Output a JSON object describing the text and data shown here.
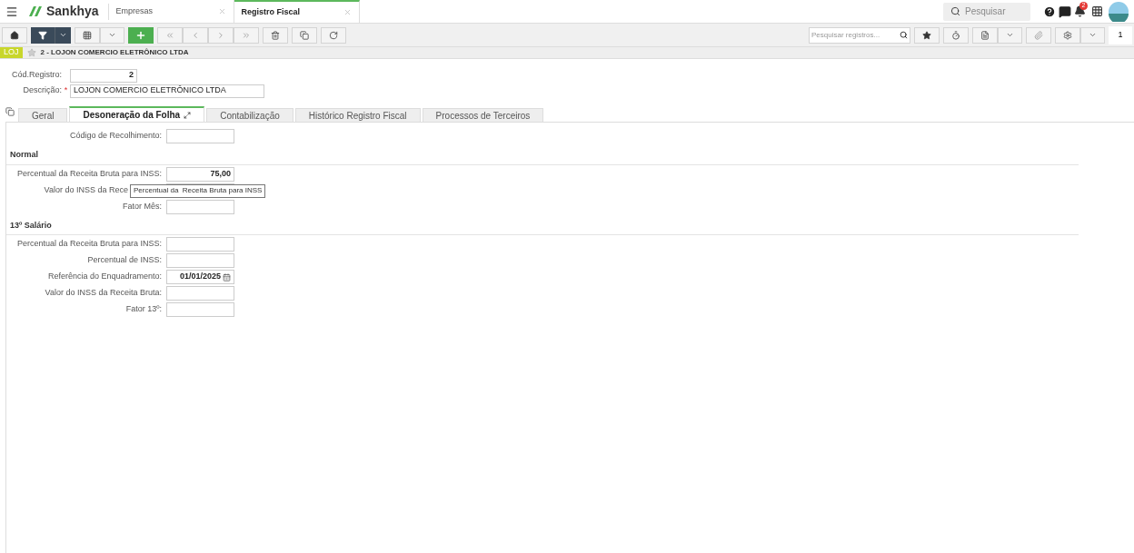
{
  "header": {
    "logo": "Sankhya",
    "tabs": [
      {
        "label": "Empresas",
        "selected": false
      },
      {
        "label": "Registro Fiscal",
        "selected": true
      }
    ],
    "search": {
      "placeholder": "Pesquisar"
    },
    "notifications": "2"
  },
  "toolbar": {
    "search": {
      "placeholder": "Pesquisar registros..."
    },
    "counter": "1"
  },
  "record": {
    "tag": "LOJ",
    "title": "2 - LOJON COMERCIO ELETRÔNICO LTDA"
  },
  "fields": [
    {
      "label": "Cód.Registro:",
      "value": "2",
      "kind": "number"
    },
    {
      "label": "Descrição:",
      "value": "LOJON COMERCIO ELETRÔNICO LTDA",
      "required_mark": "*",
      "kind": "text"
    }
  ],
  "tabs": [
    {
      "label": "Geral",
      "selected": false
    },
    {
      "label": "Desoneração da Folha",
      "selected": true
    },
    {
      "label": "Contabilização",
      "selected": false
    },
    {
      "label": "Histórico Registro Fiscal",
      "selected": false
    },
    {
      "label": "Processos de Terceiros",
      "selected": false
    }
  ],
  "top_field": {
    "label": "Código de Recolhimento:"
  },
  "sections": [
    {
      "title": "Normal",
      "fields": [
        {
          "label": "Percentual da Receita Bruta para INSS:",
          "kind": "text",
          "value": "75,00"
        },
        {
          "label": "Valor do INSS da Rece",
          "kind": "text",
          "tooltip": "Percentual da  Receita Bruta para INSS"
        },
        {
          "label": "Fator Mês:",
          "kind": "text"
        }
      ]
    },
    {
      "title": "13º Salário",
      "fields": [
        {
          "label": "Percentual da Receita Bruta para INSS:",
          "kind": "text"
        },
        {
          "label": "Percentual de INSS:",
          "kind": "text"
        },
        {
          "label": "Referência do Enquadramento:",
          "kind": "date",
          "value": "01/01/2025"
        },
        {
          "label": "Valor do INSS da Receita Bruta:",
          "kind": "text"
        },
        {
          "label": "Fator 13º:",
          "kind": "text"
        }
      ]
    }
  ]
}
